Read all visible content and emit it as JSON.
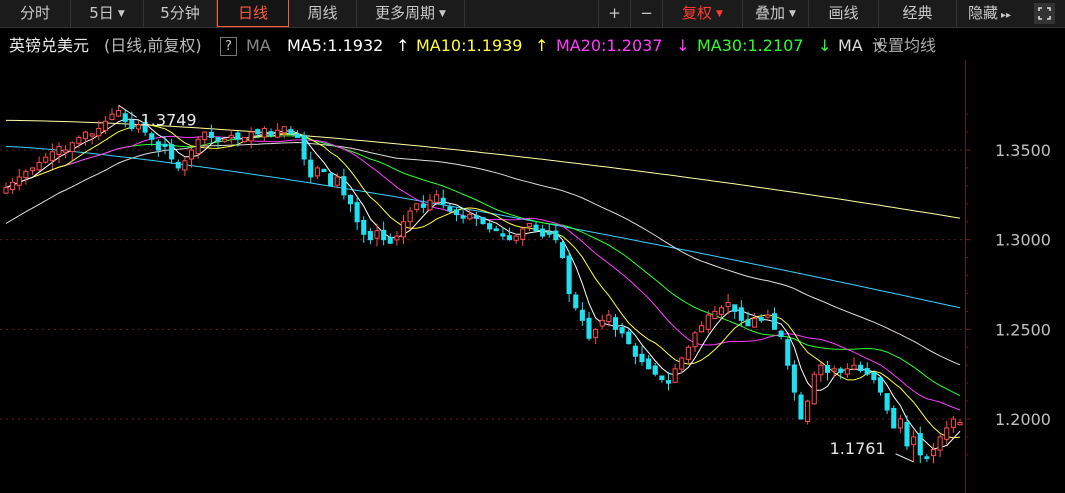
{
  "toolbar": {
    "tabs": [
      {
        "label": "分时",
        "active": false,
        "caret": false
      },
      {
        "label": "5日",
        "active": false,
        "caret": true
      },
      {
        "label": "5分钟",
        "active": false,
        "caret": false
      },
      {
        "label": "日线",
        "active": true,
        "caret": false
      },
      {
        "label": "周线",
        "active": false,
        "caret": false
      },
      {
        "label": "更多周期",
        "active": false,
        "caret": true
      }
    ],
    "zoom_in": "+",
    "zoom_out": "−",
    "fuquan": "复权",
    "overlay": "叠加",
    "draw": "画线",
    "classic": "经典",
    "hide": "隐藏",
    "hide_arrows": "▸▸"
  },
  "legend": {
    "instrument": "英镑兑美元",
    "mode": "(日线,前复权)",
    "help": "?",
    "ma_prefix": "MA",
    "ma5": "MA5:1.1932",
    "ma5_arrow": "↑",
    "ma10": "MA10:1.1939",
    "ma10_arrow": "↑",
    "ma20": "MA20:1.2037",
    "ma20_arrow": "↓",
    "ma30": "MA30:1.2107",
    "ma30_arrow": "↓",
    "ma_more": "MA",
    "settings": "设置均线"
  },
  "colors": {
    "up": "#ff4a4a",
    "down": "#20e0f0",
    "ma5": "#ffffff",
    "ma10": "#ffff3a",
    "ma20": "#ff3cff",
    "ma30": "#2cff2c",
    "ma60": "#dddddd",
    "ma120": "#3ccfff",
    "ma250": "#ffffa0",
    "active_tab": "#ff5b3d"
  },
  "chart_data": {
    "type": "candlestick",
    "ylim": [
      1.17,
      1.39
    ],
    "yticks": [
      "1.3500",
      "1.3000",
      "1.2500",
      "1.2000"
    ],
    "annotations": {
      "high": "1.3749",
      "low": "1.1761"
    },
    "closes": [
      1.329,
      1.332,
      1.335,
      1.338,
      1.34,
      1.343,
      1.346,
      1.349,
      1.352,
      1.35,
      1.354,
      1.357,
      1.36,
      1.359,
      1.362,
      1.366,
      1.37,
      1.372,
      1.366,
      1.362,
      1.364,
      1.36,
      1.356,
      1.35,
      1.352,
      1.345,
      1.34,
      1.344,
      1.35,
      1.356,
      1.36,
      1.357,
      1.355,
      1.356,
      1.358,
      1.356,
      1.357,
      1.36,
      1.359,
      1.362,
      1.358,
      1.361,
      1.363,
      1.359,
      1.357,
      1.345,
      1.335,
      1.34,
      1.338,
      1.33,
      1.335,
      1.325,
      1.32,
      1.31,
      1.303,
      1.3,
      1.305,
      1.3,
      1.298,
      1.302,
      1.31,
      1.316,
      1.32,
      1.318,
      1.322,
      1.325,
      1.32,
      1.316,
      1.314,
      1.312,
      1.314,
      1.312,
      1.309,
      1.306,
      1.305,
      1.302,
      1.3,
      1.302,
      1.306,
      1.309,
      1.305,
      1.302,
      1.303,
      1.3,
      1.29,
      1.27,
      1.262,
      1.255,
      1.245,
      1.25,
      1.255,
      1.258,
      1.25,
      1.248,
      1.242,
      1.235,
      1.232,
      1.228,
      1.225,
      1.222,
      1.22,
      1.228,
      1.234,
      1.24,
      1.248,
      1.252,
      1.258,
      1.26,
      1.262,
      1.265,
      1.26,
      1.255,
      1.252,
      1.256,
      1.255,
      1.258,
      1.25,
      1.246,
      1.23,
      1.215,
      1.2,
      1.21,
      1.225,
      1.23,
      1.226,
      1.228,
      1.226,
      1.228,
      1.23,
      1.227,
      1.225,
      1.222,
      1.215,
      1.205,
      1.195,
      1.2,
      1.185,
      1.19,
      1.18,
      1.178,
      1.183,
      1.19,
      1.195,
      1.2,
      1.198
    ]
  }
}
